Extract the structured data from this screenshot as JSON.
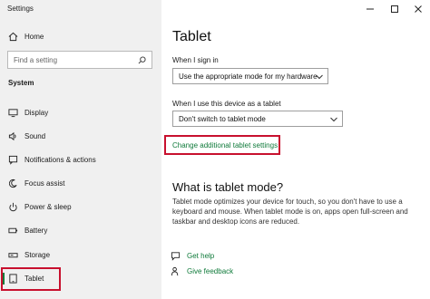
{
  "window": {
    "title": "Settings"
  },
  "sidebar": {
    "home_label": "Home",
    "search_placeholder": "Find a setting",
    "section_heading": "System",
    "items": [
      {
        "label": "Display",
        "icon": "display-icon"
      },
      {
        "label": "Sound",
        "icon": "sound-icon"
      },
      {
        "label": "Notifications & actions",
        "icon": "notifications-icon"
      },
      {
        "label": "Focus assist",
        "icon": "focus-assist-icon"
      },
      {
        "label": "Power & sleep",
        "icon": "power-icon"
      },
      {
        "label": "Battery",
        "icon": "battery-icon"
      },
      {
        "label": "Storage",
        "icon": "storage-icon"
      },
      {
        "label": "Tablet",
        "icon": "tablet-icon",
        "selected": true
      }
    ]
  },
  "main": {
    "title": "Tablet",
    "sign_in_label": "When I sign in",
    "sign_in_value": "Use the appropriate mode for my hardware",
    "tablet_label": "When I use this device as a tablet",
    "tablet_value": "Don't switch to tablet mode",
    "additional_link": "Change additional tablet settings",
    "what_is_heading": "What is tablet mode?",
    "what_is_text": "Tablet mode optimizes your device for touch, so you don't have to use a keyboard and mouse. When tablet mode is on, apps open full-screen and taskbar and desktop icons are reduced.",
    "get_help": "Get help",
    "give_feedback": "Give feedback"
  },
  "colors": {
    "accent": "#0f7a3a",
    "highlight": "#c8102e",
    "sidebar_bg": "#f0f0f0"
  }
}
